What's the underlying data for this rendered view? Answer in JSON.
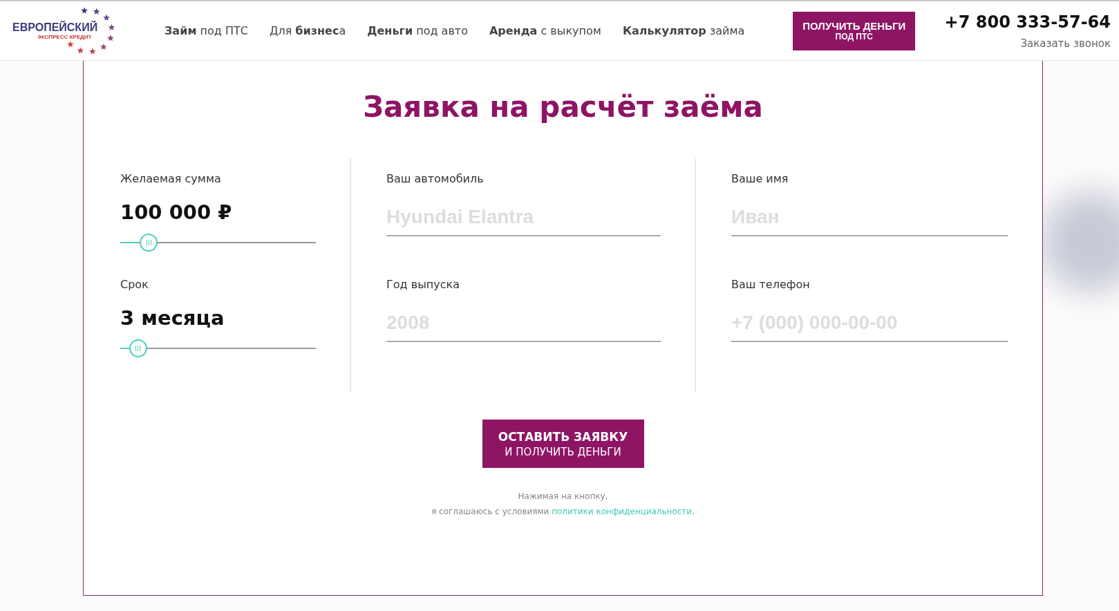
{
  "header": {
    "logo": {
      "title": "ЕВРОПЕЙСКИЙ",
      "subtitle": "ЭКСПРЕСС КРЕДИТ"
    },
    "nav": [
      "**Займ** под ПТС",
      "Для **бизнес**а",
      "**Деньги** под авто",
      "**Аренда** с выкупом",
      "**Калькулятор** займа"
    ],
    "cta": {
      "line1": "ПОЛУЧИТЬ ДЕНЬГИ",
      "line2": "ПОД ПТС"
    },
    "phone": "+7 800 333-57-64",
    "callback": "Заказать звонок"
  },
  "form": {
    "title": "Заявка на расчёт заёма",
    "sliders": [
      {
        "label": "Желаемая сумма",
        "value": "100 000 ₽",
        "level": 0.11
      },
      {
        "label": "Срок",
        "value": "3 месяца",
        "level": 0.05
      }
    ],
    "fields": [
      {
        "label": "Ваш автомобиль",
        "placeholder": "Hyundai Elantra"
      },
      {
        "label": "Год выпуска",
        "placeholder": "2008"
      },
      {
        "label": "Ваше имя",
        "placeholder": "Иван"
      },
      {
        "label": "Ваш телефон",
        "placeholder": "+7 (000) 000-00-00"
      }
    ],
    "submit": {
      "line1": "ОСТАВИТЬ ЗАЯВКУ",
      "line2": "И ПОЛУЧИТЬ ДЕНЬГИ"
    },
    "consent": {
      "line1": "Нажимая на кнопку,",
      "line2": "я соглашаюсь с условиями",
      "link": "политики конфиденциальности",
      "end": "."
    }
  }
}
